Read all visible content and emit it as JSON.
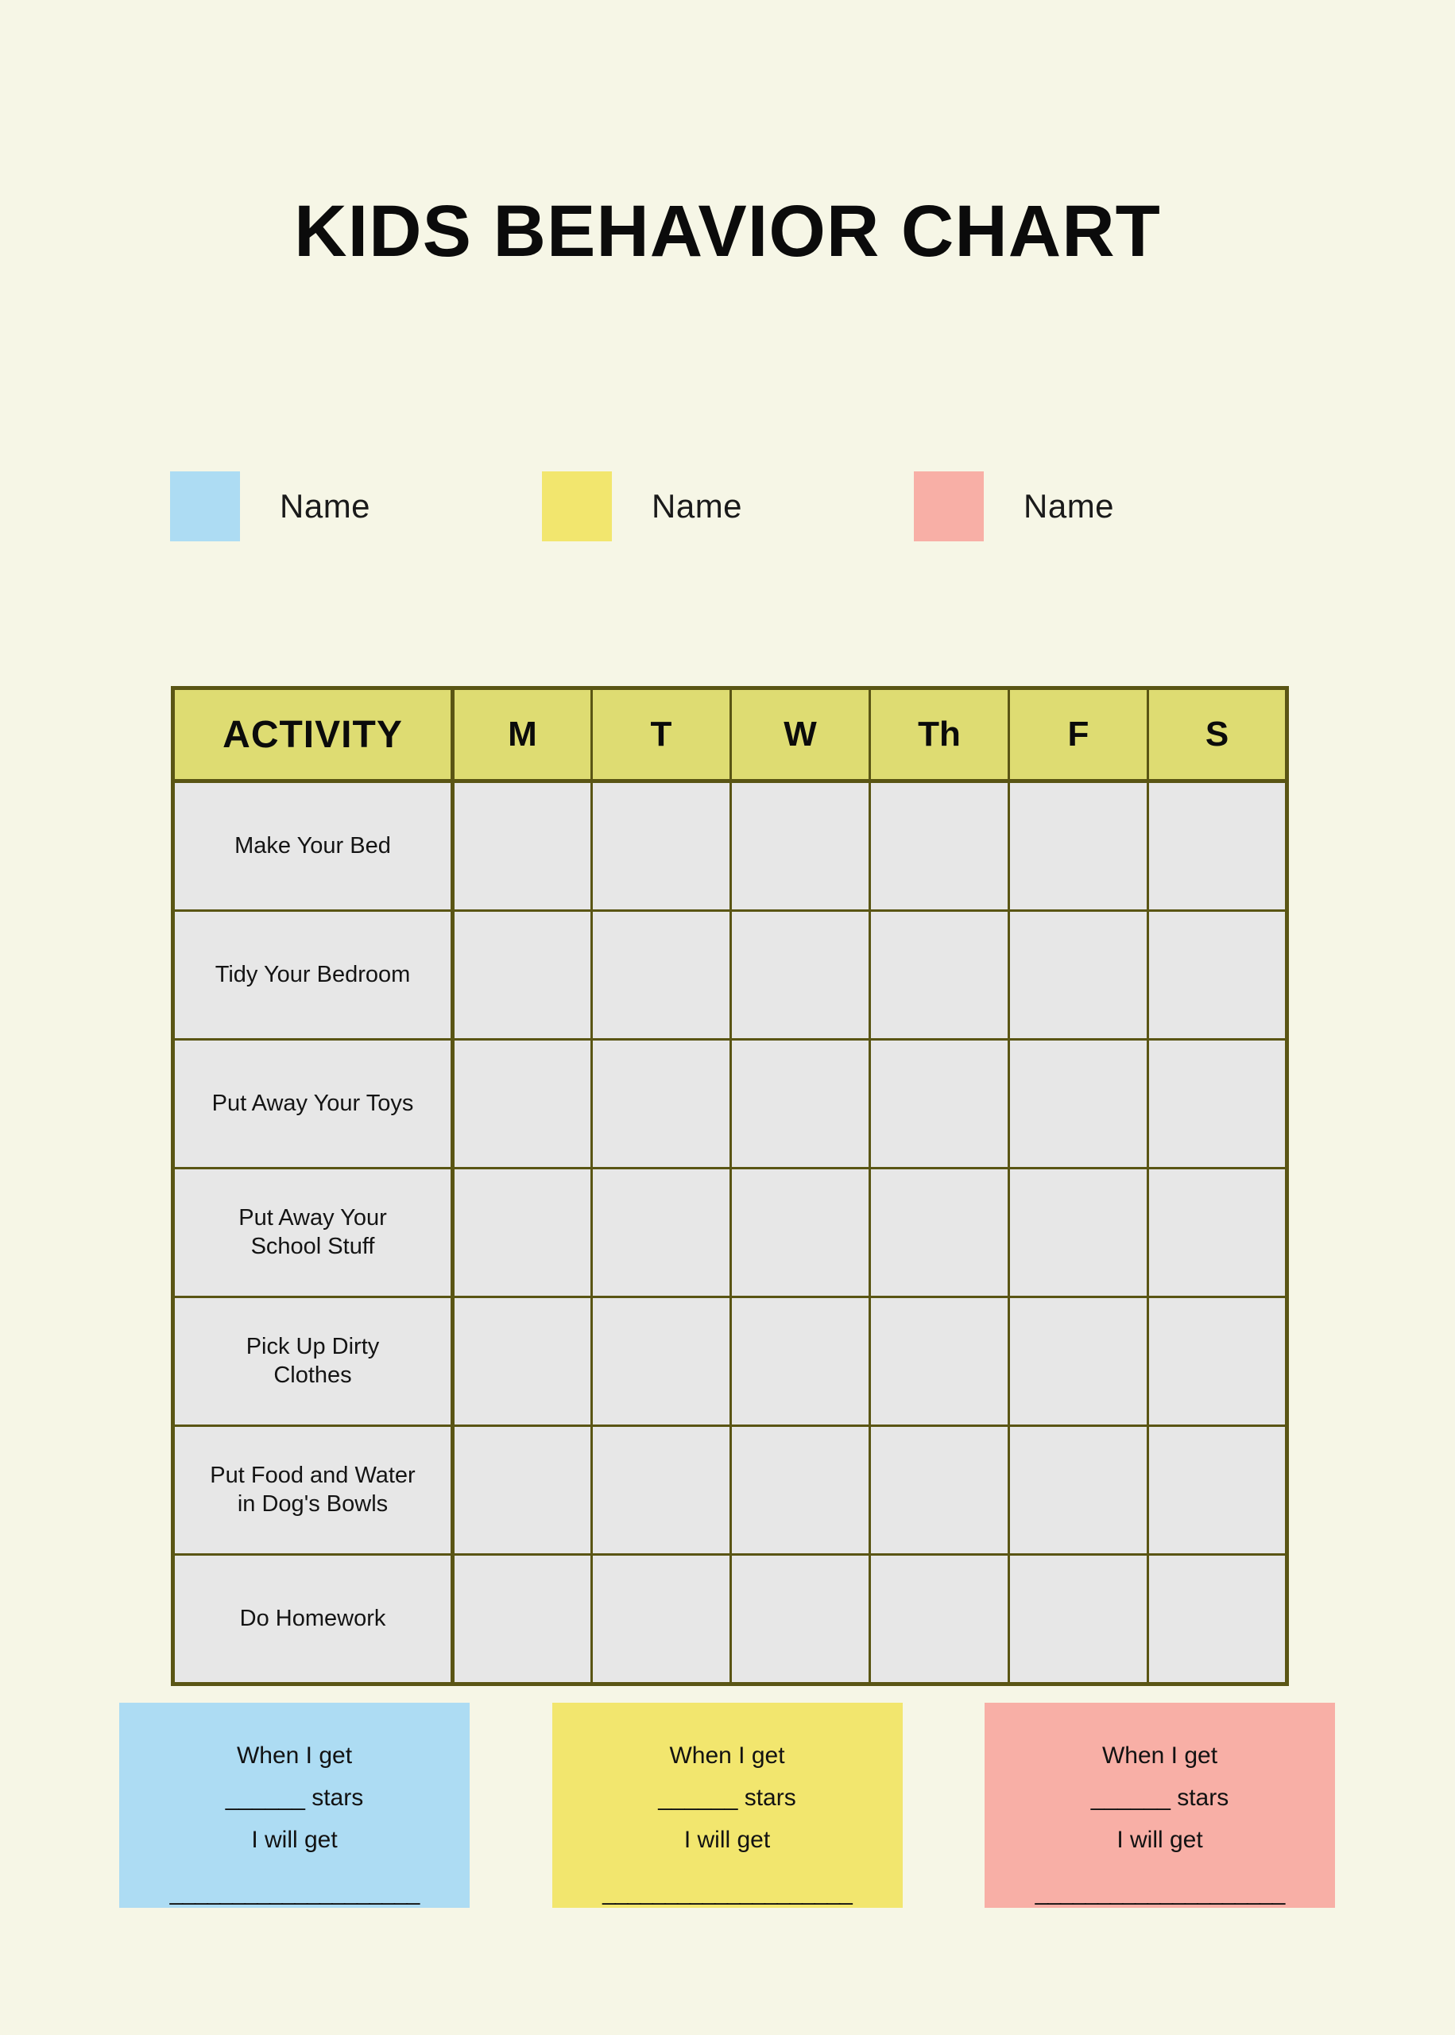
{
  "page": {
    "background_color": "#F6F6E6",
    "title": "KIDS BEHAVIOR CHART"
  },
  "legend": {
    "items": [
      {
        "label": "Name",
        "color": "#ADDCF3"
      },
      {
        "label": "Name",
        "color": "#F2E66E"
      },
      {
        "label": "Name",
        "color": "#F8AFA6"
      }
    ]
  },
  "chart_data": {
    "type": "table",
    "title": "KIDS BEHAVIOR CHART",
    "header_background": "#DEDC72",
    "cell_background": "#E7E7E7",
    "border_color": "#5A5514",
    "columns": [
      "ACTIVITY",
      "M",
      "T",
      "W",
      "Th",
      "F",
      "S"
    ],
    "day_columns": [
      "M",
      "T",
      "W",
      "Th",
      "F",
      "S"
    ],
    "rows": [
      {
        "activity": "Make Your Bed",
        "values": [
          "",
          "",
          "",
          "",
          "",
          ""
        ]
      },
      {
        "activity": "Tidy Your Bedroom",
        "values": [
          "",
          "",
          "",
          "",
          "",
          ""
        ]
      },
      {
        "activity": "Put Away Your Toys",
        "values": [
          "",
          "",
          "",
          "",
          "",
          ""
        ]
      },
      {
        "activity": "Put Away Your\nSchool Stuff",
        "values": [
          "",
          "",
          "",
          "",
          "",
          ""
        ]
      },
      {
        "activity": "Pick Up Dirty\nClothes",
        "values": [
          "",
          "",
          "",
          "",
          "",
          ""
        ]
      },
      {
        "activity": "Put Food and Water\nin Dog's Bowls",
        "values": [
          "",
          "",
          "",
          "",
          "",
          ""
        ]
      },
      {
        "activity": "Do Homework",
        "values": [
          "",
          "",
          "",
          "",
          "",
          ""
        ]
      }
    ]
  },
  "rewards": {
    "boxes": [
      {
        "color": "#ADDCF3",
        "line1": "When I get",
        "line2": "______ stars",
        "line3": "I will get",
        "line4": "____________________"
      },
      {
        "color": "#F2E66E",
        "line1": "When I get",
        "line2": "______ stars",
        "line3": "I will get",
        "line4": "____________________"
      },
      {
        "color": "#F8AFA6",
        "line1": "When I get",
        "line2": "______ stars",
        "line3": "I will get",
        "line4": "____________________"
      }
    ]
  }
}
